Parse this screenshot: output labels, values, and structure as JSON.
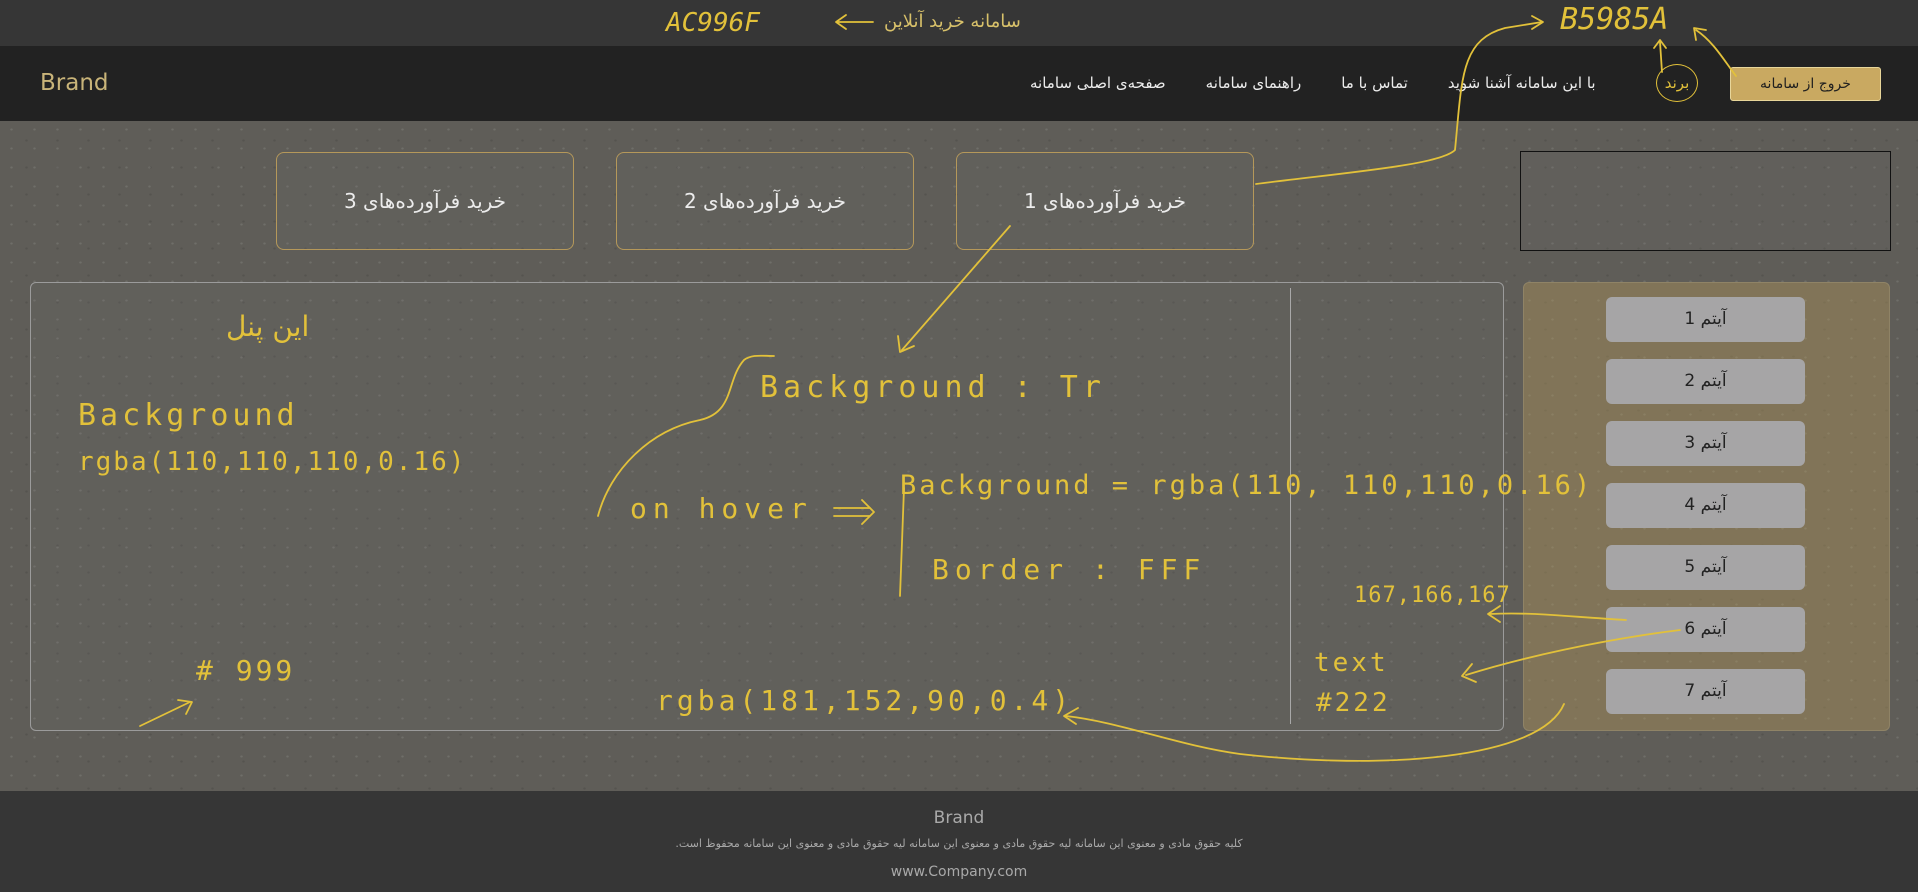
{
  "top_strip": {
    "title": "سامانه خرید آنلاین"
  },
  "navbar": {
    "brand": "Brand",
    "links": [
      "صفحه‌ی اصلی سامانه",
      "راهنمای سامانه",
      "تماس با ما",
      "با این سامانه آشنا شوید"
    ],
    "brand_badge": "برند",
    "logout": "خروج از سامانه"
  },
  "products": [
    "خرید فرآورده‌های 1",
    "خرید فرآورده‌های 2",
    "خرید فرآورده‌های 3"
  ],
  "sidebar": {
    "items": [
      "آیتم 1",
      "آیتم 2",
      "آیتم 3",
      "آیتم 4",
      "آیتم 5",
      "آیتم 6",
      "آیتم 7"
    ]
  },
  "footer": {
    "brand": "Brand",
    "copyright": ".کلیه حقوق مادی و معنوی این سامانه لیه حقوق مادی و معنوی این سامانه لیه حقوق مادی و معنوی این سامانه محفوظ است",
    "url": "www.Company.com"
  },
  "annotations": {
    "top_color": "AC996F",
    "top_right_color": "B5985A",
    "panel_label": "این پنل",
    "panel_bg_label": "Background",
    "panel_bg_value": "rgba(110,110,110,0.16)",
    "panel_border": "# 999",
    "hover_bg_title": "Background : Tr",
    "on_hover": "on hover",
    "hover_bg": "Background = rgba(110, 110,110,0.16)",
    "hover_border": "Border : FFF",
    "item_color": "167,166,167",
    "text_label": "text",
    "text_color": "#222",
    "sidebar_bg": "rgba(181,152,90,0.4)"
  },
  "colors": {
    "accent": "#e2c13a",
    "button_gold": "#c9a961",
    "sidebar_bg": "rgba(181,152,90,0.4)",
    "panel_border": "#999999",
    "item_bg": "#a7a6a7",
    "item_text": "#222222"
  }
}
